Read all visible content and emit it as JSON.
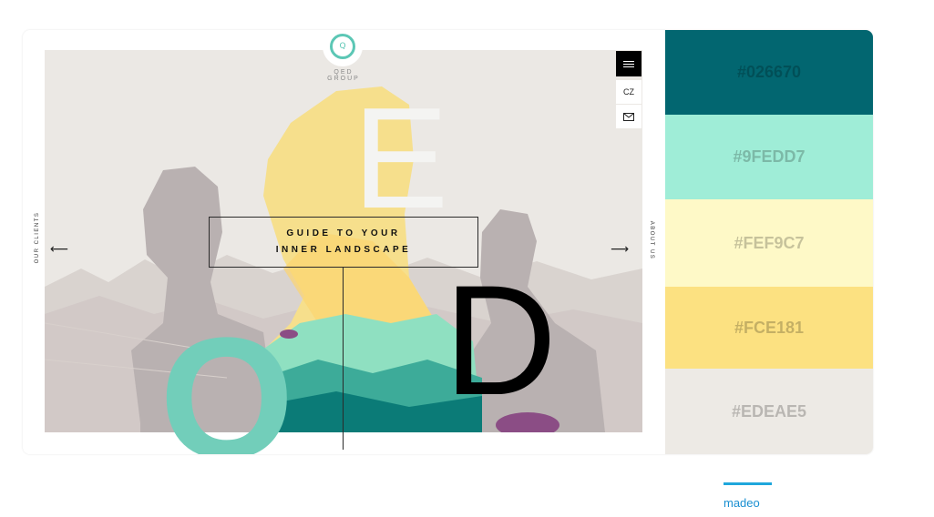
{
  "website": {
    "brand": "QED GROUP",
    "logo_letter": "Q",
    "headline_line1": "GUIDE TO YOUR",
    "headline_line2": "INNER LANDSCAPE",
    "lang_label": "CZ",
    "left_side_label": "OUR CLIENTS",
    "right_side_label": "ABOUT US",
    "arrow_left": "⟵",
    "arrow_right": "⟶",
    "letters": {
      "e": "E",
      "d": "D",
      "q": "Q"
    }
  },
  "palette": [
    {
      "hex": "#026670",
      "label": "#026670"
    },
    {
      "hex": "#9FEDD7",
      "label": "#9FEDD7"
    },
    {
      "hex": "#FEF9C7",
      "label": "#FEF9C7"
    },
    {
      "hex": "#FCE181",
      "label": "#FCE181"
    },
    {
      "hex": "#EDEAE5",
      "label": "#EDEAE5"
    }
  ],
  "credit": {
    "label": "madeo",
    "accent": "#1fa7dc"
  }
}
